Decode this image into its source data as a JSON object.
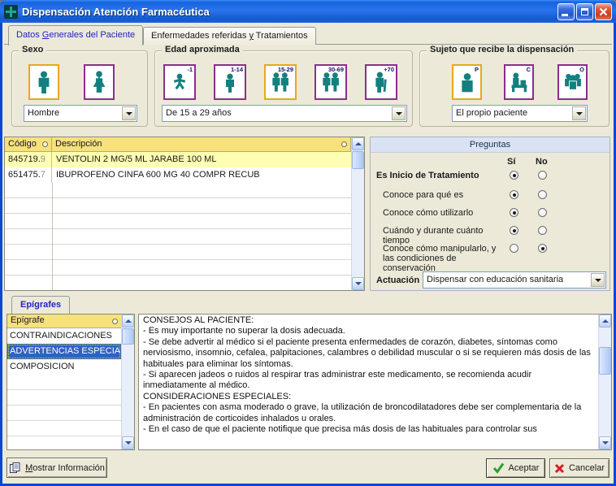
{
  "colors": {
    "icon_teal": "#12807E",
    "selected_border_orange": "#E8A81C",
    "unselected_border_purple": "#8B2F8B",
    "table_header_yellow": "#F7E17A",
    "selected_row_yellow": "#FFFFB4",
    "list_selection_blue": "#2F62C2",
    "preguntas_header_blue": "#D9E3F3",
    "titlebar_blue": "#2A74EA"
  },
  "window": {
    "title": "Dispensación Atención Farmacéutica"
  },
  "tabs": {
    "datos": {
      "pre": "Datos ",
      "key": "G",
      "post": "enerales del Paciente"
    },
    "enfermedades": {
      "pre": "Enfermedades referidas ",
      "key": "y",
      "post": " Tratamientos"
    }
  },
  "sexo": {
    "title": "Sexo",
    "male_selected": true,
    "female_selected": false,
    "value": "Hombre"
  },
  "edad": {
    "title": "Edad aproximada",
    "value": "De 15 a 29 años",
    "options": [
      {
        "label": "-1",
        "selected": false
      },
      {
        "label": "1-14",
        "selected": false
      },
      {
        "label": "15-29",
        "selected": true
      },
      {
        "label": "30-69",
        "selected": false
      },
      {
        "label": "+70",
        "selected": false
      }
    ]
  },
  "sujeto": {
    "title": "Sujeto que recibe la dispensación",
    "value": "El propio paciente",
    "options": [
      {
        "label": "P",
        "selected": true
      },
      {
        "label": "C",
        "selected": false
      },
      {
        "label": "O",
        "selected": false
      }
    ]
  },
  "medications": {
    "col_codigo": "Código",
    "col_descripcion": "Descripción",
    "rows": [
      {
        "code": "845719.",
        "dv": "9",
        "desc": "VENTOLIN 2 MG/5 ML JARABE 100 ML",
        "selected": true
      },
      {
        "code": "651475.",
        "dv": "7",
        "desc": "IBUPROFENO CINFA 600 MG 40 COMPR RECUB",
        "selected": false
      }
    ]
  },
  "preguntas": {
    "title": "Preguntas",
    "yes": "Sí",
    "no": "No",
    "items": [
      {
        "label": "Es Inicio de Tratamiento",
        "answer": "si"
      },
      {
        "label": "Conoce para qué es",
        "answer": "si"
      },
      {
        "label": "Conoce cómo utilizarlo",
        "answer": "si"
      },
      {
        "label": "Cuándo y durante cuánto tiempo",
        "answer": "si"
      },
      {
        "label": "Conoce cómo manipularlo, y las condiciones de conservación",
        "answer": "no"
      }
    ],
    "actuacion_label": "Actuación",
    "actuacion_value": "Dispensar con educación sanitaria"
  },
  "epigrafes": {
    "tab": "Epígrafes",
    "header": "Epígrafe",
    "items": [
      {
        "label": "CONTRAINDICACIONES",
        "selected": false
      },
      {
        "label": "ADVERTENCIAS ESPECIAL...",
        "selected": true
      },
      {
        "label": "COMPOSICION",
        "selected": false
      }
    ],
    "content": "CONSEJOS AL PACIENTE:\n- Es muy importante no superar la dosis adecuada.\n- Se debe advertir al médico si el paciente presenta enfermedades de corazón, diabetes, síntomas como nerviosismo, insomnio, cefalea, palpitaciones, calambres o debilidad muscular o si se requieren más dosis de las habituales para eliminar los síntomas.\n- Si aparecen jadeos o ruidos al respirar tras administrar este medicamento, se recomienda acudir inmediatamente al médico.\nCONSIDERACIONES ESPECIALES:\n- En pacientes con asma moderado o grave, la utilización de broncodilatadores debe ser complementaria de la administración de corticoides inhalados u orales.\n- En el caso de que el paciente notifique que precisa más dosis de las habituales para controlar sus"
  },
  "footer": {
    "mostrar_key": "M",
    "mostrar_post": "ostrar Información",
    "aceptar": "Aceptar",
    "cancelar": "Cancelar"
  }
}
